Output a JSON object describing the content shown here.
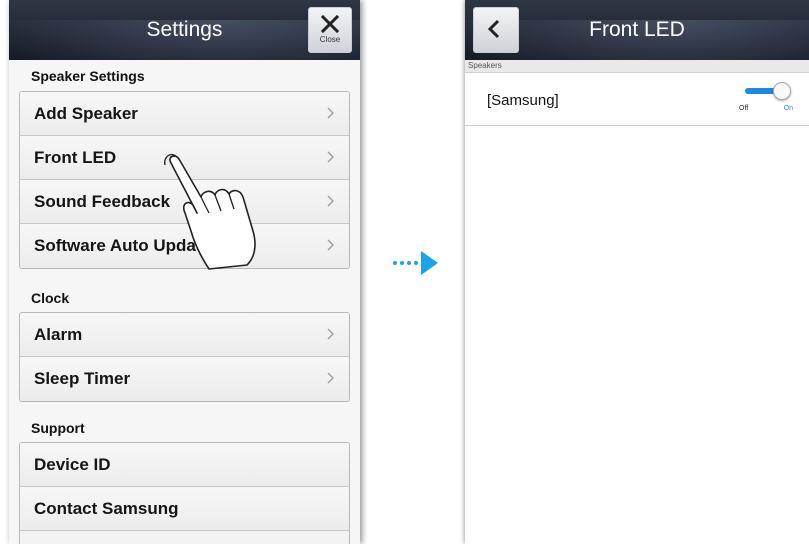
{
  "left_screen": {
    "title": "Settings",
    "close_label": "Close",
    "sections": [
      {
        "label": "Speaker Settings",
        "items": [
          {
            "label": "Add Speaker",
            "icon": "chevron-right-icon"
          },
          {
            "label": "Front LED",
            "icon": "chevron-right-icon"
          },
          {
            "label": "Sound Feedback",
            "icon": "chevron-right-icon"
          },
          {
            "label": "Software Auto Update",
            "icon": "chevron-right-icon"
          }
        ]
      },
      {
        "label": "Clock",
        "items": [
          {
            "label": "Alarm",
            "icon": "chevron-right-icon"
          },
          {
            "label": "Sleep Timer",
            "icon": "chevron-right-icon"
          }
        ]
      },
      {
        "label": "Support",
        "items": [
          {
            "label": "Device ID"
          },
          {
            "label": "Contact Samsung"
          }
        ]
      }
    ]
  },
  "right_screen": {
    "title": "Front LED",
    "section_label": "Speakers",
    "speaker_name": "[Samsung]",
    "toggle": {
      "off_label": "Off",
      "on_label": "On",
      "state": "on"
    }
  },
  "colors": {
    "header": "#1f2532",
    "accent": "#1e88e5",
    "arrow": "#1aa3e8"
  }
}
